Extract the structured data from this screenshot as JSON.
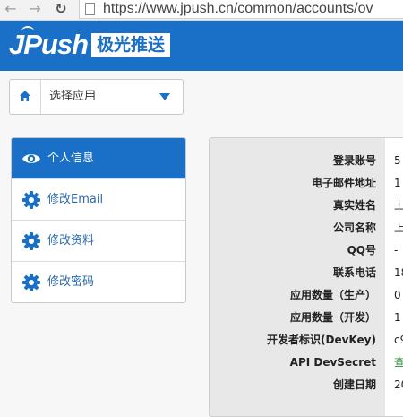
{
  "browser": {
    "url": "https://www.jpush.cn/common/accounts/ov"
  },
  "header": {
    "logo_en": "JPush",
    "logo_cn": "极光推送"
  },
  "app_selector": {
    "label": "选择应用"
  },
  "menu": {
    "items": [
      {
        "label": "个人信息",
        "icon": "eye-icon",
        "active": true
      },
      {
        "label": "修改Email",
        "icon": "gear-icon",
        "active": false
      },
      {
        "label": "修改资料",
        "icon": "gear-icon",
        "active": false
      },
      {
        "label": "修改密码",
        "icon": "gear-icon",
        "active": false
      }
    ]
  },
  "account": {
    "rows": [
      {
        "label": "登录账号",
        "value": "5"
      },
      {
        "label": "电子邮件地址",
        "value": "1"
      },
      {
        "label": "真实姓名",
        "value": "上"
      },
      {
        "label": "公司名称",
        "value": "上"
      },
      {
        "label": "QQ号",
        "value": "-"
      },
      {
        "label": "联系电话",
        "value": "18"
      },
      {
        "label": "应用数量（生产）",
        "value": "0"
      },
      {
        "label": "应用数量（开发）",
        "value": "1"
      },
      {
        "label": "开发者标识(DevKey)",
        "value": "c9"
      },
      {
        "label": "API DevSecret",
        "value": "查"
      },
      {
        "label": "创建日期",
        "value": "20"
      }
    ]
  },
  "colors": {
    "brand_blue": "#1a6fc6",
    "link_green": "#2e8b3a"
  }
}
